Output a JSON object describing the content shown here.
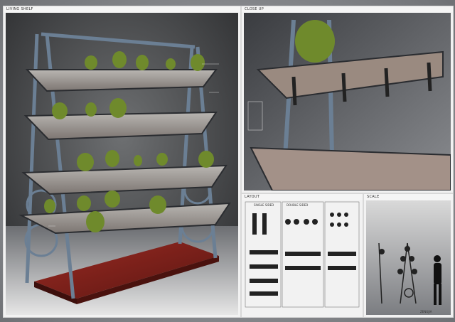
{
  "panels": {
    "main": {
      "title": "LIVING SHELF"
    },
    "closeup": {
      "title": "CLOSE UP"
    },
    "layout": {
      "title": "LAYOUT",
      "labels": {
        "single_sided": "SINGLE SIDED",
        "double_sided": "DOUBLE SIDED"
      }
    },
    "scale": {
      "title": "SCALE"
    }
  },
  "footer_signature": "ZENGJIA",
  "colors": {
    "background": "#8d8f93",
    "frame_steel": "#6b7f94",
    "planter_rust": "#9a8a80",
    "base_wood": "#7a1f1a",
    "plant_green": "#6f8a2c",
    "panel_white": "#f2f2f2"
  }
}
